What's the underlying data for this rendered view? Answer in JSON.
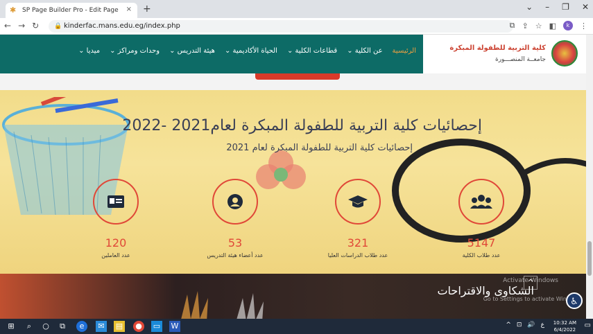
{
  "browser": {
    "tab_title": "SP Page Builder Pro - Edit Page",
    "tab_close": "×",
    "new_tab": "+",
    "url": "kinderfac.mans.edu.eg/index.php",
    "profile_initial": "k"
  },
  "header": {
    "logo_title": "كلية التربية للطفولة المبكرة",
    "logo_subtitle": "جامعــة المنصـــورة",
    "menu": [
      {
        "label": "الرئيسية",
        "active": true
      },
      {
        "label": "عن الكلية ⌄",
        "active": false
      },
      {
        "label": "قطاعات الكلية ⌄",
        "active": false
      },
      {
        "label": "الحياة الأكاديمية ⌄",
        "active": false
      },
      {
        "label": "هيئة التدريس ⌄",
        "active": false
      },
      {
        "label": "وحدات ومراكز ⌄",
        "active": false
      },
      {
        "label": "ميديا ⌄",
        "active": false
      }
    ]
  },
  "stats": {
    "title": "إحصائيات كلية التربية للطفولة المبكرة لعام2021 -2022",
    "subtitle": "إحصائيات كلية التربية للطفولة المبكرة لعام 2021",
    "items": [
      {
        "number": "120",
        "label": "عدد العاملين",
        "icon": "id-card-icon"
      },
      {
        "number": "53",
        "label": "عدد أعضاء هيئة التدريس",
        "icon": "user-icon"
      },
      {
        "number": "321",
        "label": "عدد طلاب الدراسات العليا",
        "icon": "graduation-cap-icon"
      },
      {
        "number": "5147",
        "label": "عدد طلاب الكلية",
        "icon": "users-icon"
      }
    ]
  },
  "complaints": {
    "title": "الشكاوى والاقتراحات",
    "activate_1": "Activate Windows",
    "activate_2": "Go to Settings to activate Windows."
  },
  "taskbar": {
    "time": "10:32 AM",
    "date": "6/4/2022",
    "lang": "ع"
  },
  "colors": {
    "header_bg": "#0d6b66",
    "accent": "#e04838",
    "active_menu": "#f0a040"
  }
}
